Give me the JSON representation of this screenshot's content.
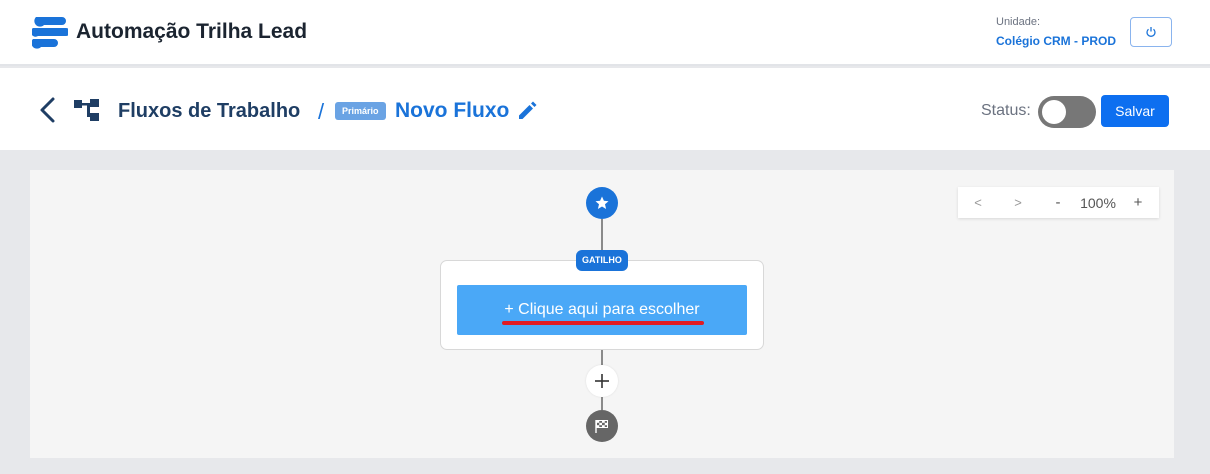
{
  "header": {
    "app_title": "Automação Trilha Lead",
    "unit_label": "Unidade:",
    "unit_value": "Colégio CRM - PROD",
    "icons": {
      "logo": "stacked-bars-logo",
      "power": "power-icon"
    }
  },
  "subheader": {
    "breadcrumb_title": "Fluxos de Trabalho",
    "separator": "/",
    "badge": "Primário",
    "flow_name": "Novo Fluxo",
    "status_label": "Status:",
    "status_on": false,
    "save_label": "Salvar",
    "icons": {
      "back": "chevron-left-icon",
      "flow": "flow-tree-icon",
      "edit": "pencil-icon"
    }
  },
  "canvas": {
    "zoom": {
      "prev": "<",
      "next": ">",
      "minus": "-",
      "level": "100%",
      "plus": "+"
    },
    "trigger_tag": "GATILHO",
    "choose_label": "+ Clique aqui para escolher",
    "icons": {
      "start": "star-icon",
      "add": "plus-icon",
      "end": "checkered-flag-icon"
    }
  },
  "colors": {
    "primary": "#1a73d9",
    "button": "#0d6ff0",
    "choose_button": "#4aa8f7",
    "underline": "#e01b24"
  }
}
